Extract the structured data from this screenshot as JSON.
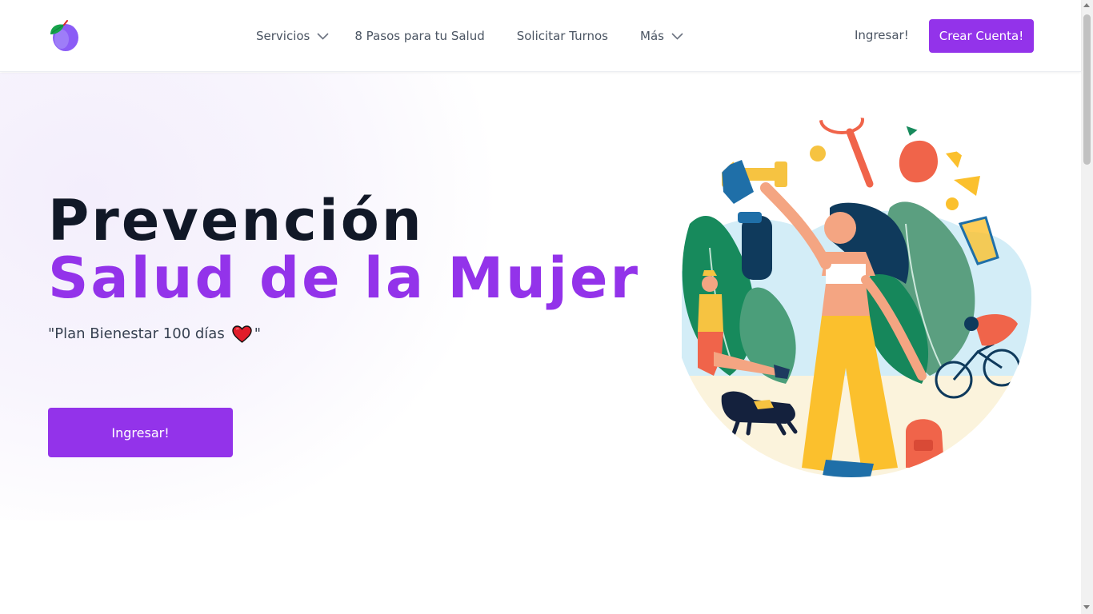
{
  "header": {
    "logo_icon": "plum-fruit-icon",
    "nav": [
      {
        "label": "Servicios",
        "icon": "chevron-down-icon"
      },
      {
        "label": "8 Pasos para tu Salud"
      },
      {
        "label": "Solicitar Turnos"
      },
      {
        "label": "Más",
        "icon": "chevron-down-icon"
      }
    ],
    "login_label": "Ingresar!",
    "signup_label": "Crear Cuenta!"
  },
  "hero": {
    "title": "Prevención",
    "subtitle": "Salud de la Mujer",
    "quote_open": "\"Plan Bienestar 100 días",
    "quote_icon": "heart-icon",
    "quote_close": "\"",
    "button_label": "Ingresar!",
    "illustration": "wellness-activities-illustration"
  },
  "colors": {
    "accent": "#9333ea",
    "title": "#111827",
    "nav_text": "#4b5563"
  }
}
